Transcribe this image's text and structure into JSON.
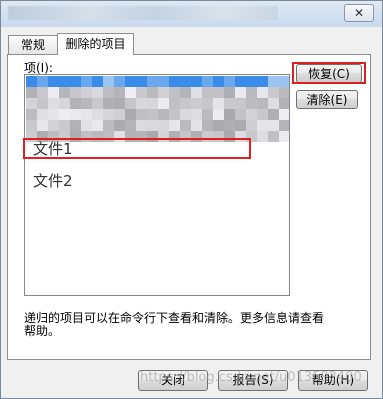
{
  "window": {
    "close_symbol": "✕"
  },
  "tabs": [
    {
      "label": "常规"
    },
    {
      "label": "删除的项目"
    }
  ],
  "items_label": "项(I):",
  "list": {
    "items": [
      {
        "label": "文件1"
      },
      {
        "label": "文件2"
      }
    ]
  },
  "buttons": {
    "restore": "恢复(C)",
    "clear": "清除(E)",
    "ok": "关闭",
    "report": "报告(S)",
    "help": "帮助(H)"
  },
  "help_text": "递归的项目可以在命令行下查看和清除。更多信息请查看帮助。",
  "watermark": "https://blog.csdn.net/u013592400",
  "colors": {
    "highlight": "#e02020",
    "accent": "#3b8be8"
  }
}
